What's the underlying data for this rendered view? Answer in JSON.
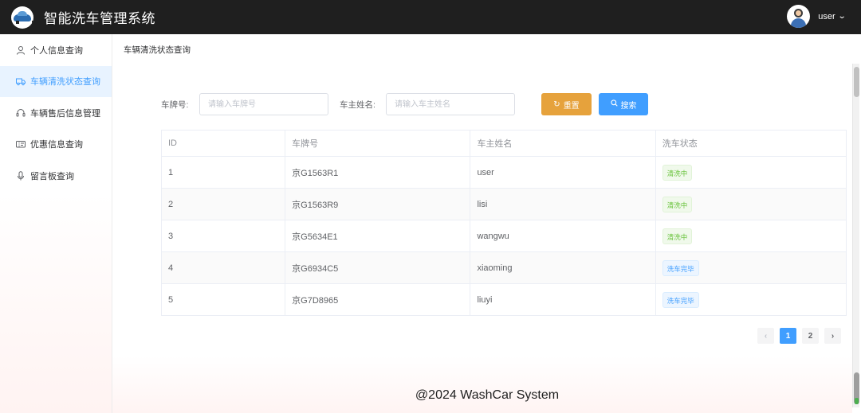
{
  "app": {
    "title": "智能洗车管理系统"
  },
  "user": {
    "name": "user"
  },
  "sidebar": {
    "items": [
      {
        "label": "个人信息查询",
        "icon": "user-icon"
      },
      {
        "label": "车辆清洗状态查询",
        "icon": "truck-icon",
        "active": true
      },
      {
        "label": "车辆售后信息管理",
        "icon": "headset-icon"
      },
      {
        "label": "优惠信息查询",
        "icon": "coupon-icon"
      },
      {
        "label": "留言板查询",
        "icon": "microphone-icon"
      }
    ]
  },
  "breadcrumb": "车辆清洗状态查询",
  "filters": {
    "plate_label": "车牌号:",
    "plate_placeholder": "请输入车牌号",
    "owner_label": "车主姓名:",
    "owner_placeholder": "请输入车主姓名",
    "reset_label": "重置",
    "search_label": "搜索"
  },
  "table": {
    "headers": [
      "ID",
      "车牌号",
      "车主姓名",
      "洗车状态"
    ],
    "rows": [
      {
        "id": "1",
        "plate": "京G1563R1",
        "owner": "user",
        "status": "清洗中"
      },
      {
        "id": "2",
        "plate": "京G1563R9",
        "owner": "lisi",
        "status": "清洗中"
      },
      {
        "id": "3",
        "plate": "京G5634E1",
        "owner": "wangwu",
        "status": "清洗中"
      },
      {
        "id": "4",
        "plate": "京G6934C5",
        "owner": "xiaoming",
        "status": "洗车完毕"
      },
      {
        "id": "5",
        "plate": "京G7D8965",
        "owner": "liuyi",
        "status": "洗车完毕"
      }
    ]
  },
  "pagination": {
    "prev": "‹",
    "pages": [
      "1",
      "2"
    ],
    "next": "›",
    "current": "1"
  },
  "footer": "@2024 WashCar System",
  "colors": {
    "header_bg": "#1f1f1f",
    "primary": "#409eff",
    "warning": "#e6a23c",
    "success": "#67c23a"
  }
}
